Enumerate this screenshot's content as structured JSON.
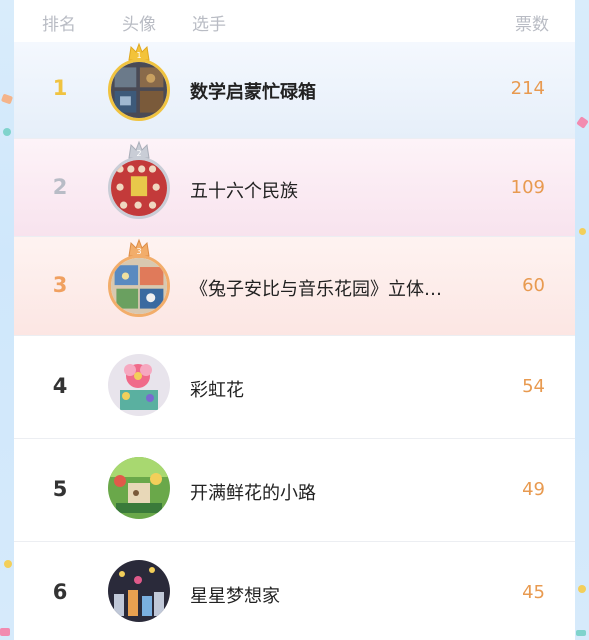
{
  "colors": {
    "rank1_bg": "#e9f1fb",
    "rank2_bg": "#f9e6f0",
    "rank3_bg": "#fde8e6",
    "rank1_text": "#f0c340",
    "rank2_text": "#b8bcc6",
    "rank3_text": "#f0a060",
    "rank_other_text": "#333333",
    "votes_text": "#e89a50"
  },
  "header": {
    "rank_label": "排名",
    "avatar_label": "头像",
    "player_label": "选手",
    "votes_label": "票数"
  },
  "rows": [
    {
      "rank": "1",
      "name": "数学启蒙忙碌箱",
      "votes": "214",
      "avatar_icon": "busy-box-photo",
      "badge": "gold-crown-icon"
    },
    {
      "rank": "2",
      "name": "五十六个民族",
      "votes": "109",
      "avatar_icon": "ethnic-groups-photo",
      "badge": "silver-crown-icon"
    },
    {
      "rank": "3",
      "name": "《兔子安比与音乐花园》立体…",
      "votes": "60",
      "avatar_icon": "popup-book-photo",
      "badge": "bronze-crown-icon"
    },
    {
      "rank": "4",
      "name": "彩虹花",
      "votes": "54",
      "avatar_icon": "rainbow-flower-photo"
    },
    {
      "rank": "5",
      "name": "开满鲜花的小路",
      "votes": "49",
      "avatar_icon": "flower-path-photo"
    },
    {
      "rank": "6",
      "name": "星星梦想家",
      "votes": "45",
      "avatar_icon": "star-dreamer-photo"
    }
  ]
}
